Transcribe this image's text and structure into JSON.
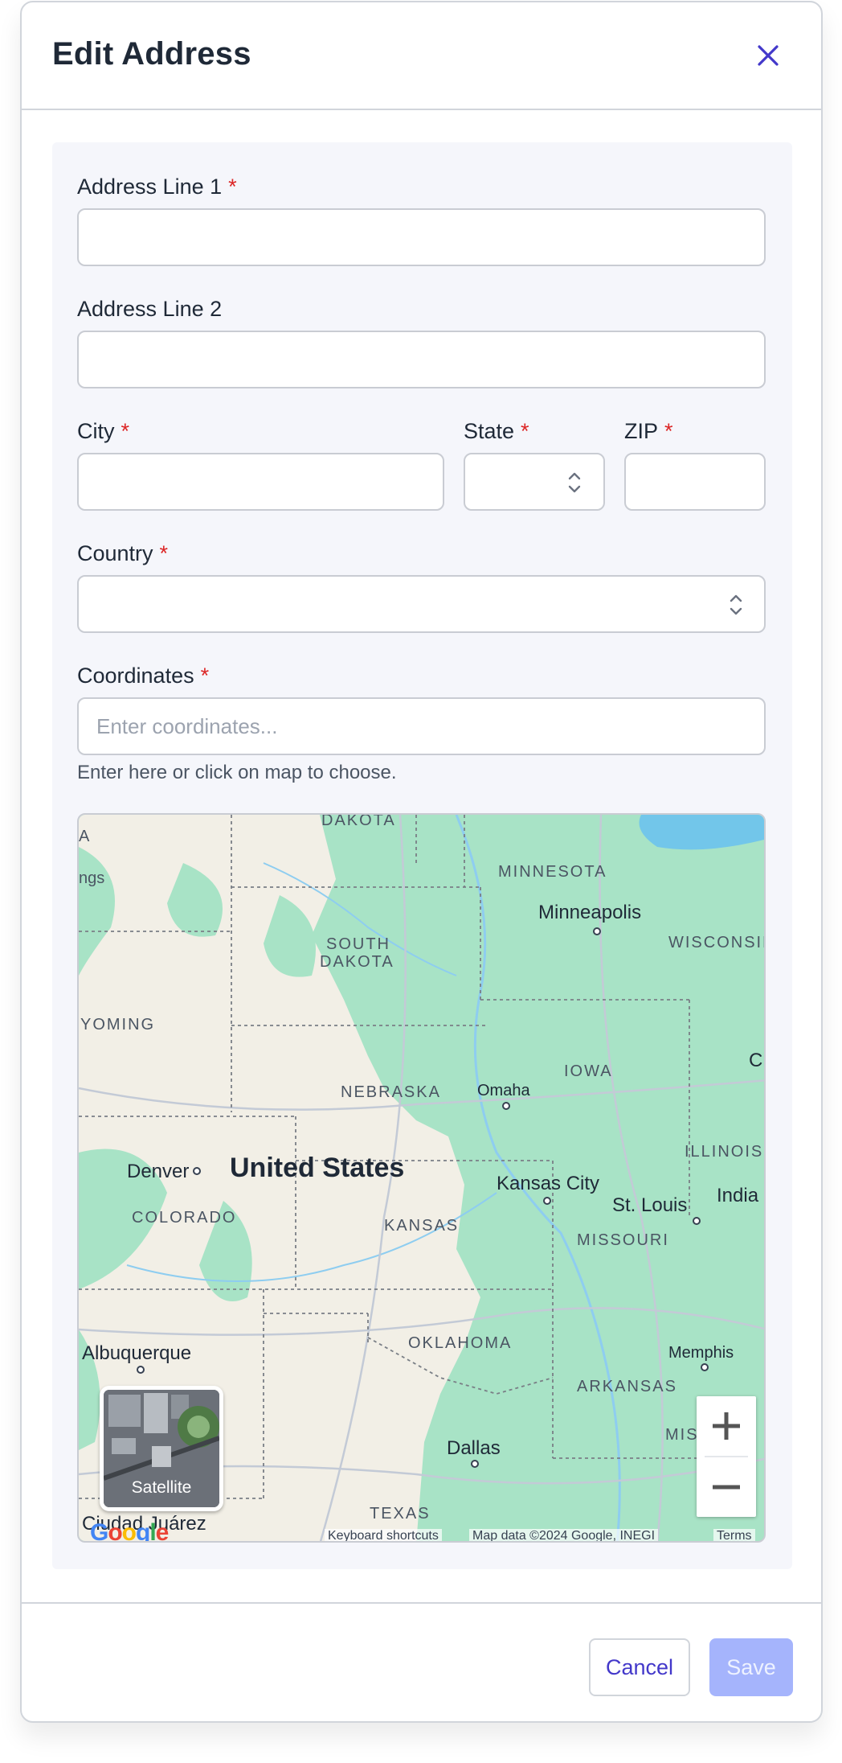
{
  "dialog": {
    "title": "Edit Address",
    "close_icon": "close-icon"
  },
  "form": {
    "address_line1": {
      "label": "Address Line 1",
      "required": "*",
      "value": ""
    },
    "address_line2": {
      "label": "Address Line 2",
      "value": ""
    },
    "city": {
      "label": "City",
      "required": "*",
      "value": ""
    },
    "state": {
      "label": "State",
      "required": "*",
      "value": ""
    },
    "zip": {
      "label": "ZIP",
      "required": "*",
      "value": ""
    },
    "country": {
      "label": "Country",
      "required": "*",
      "value": ""
    },
    "coordinates": {
      "label": "Coordinates",
      "required": "*",
      "placeholder": "Enter coordinates...",
      "value": "",
      "hint": "Enter here or click on map to choose."
    }
  },
  "map": {
    "country_label": "United States",
    "state_labels": [
      "DAKOTA",
      "MINNESOTA",
      "SOUTH",
      "DAKOTA",
      "WISCONSIN",
      "YOMING",
      "IOWA",
      "NEBRASKA",
      "ILLINOIS",
      "COLORADO",
      "KANSAS",
      "MISSOURI",
      "OKLAHOMA",
      "ARKANSAS",
      "TEXAS",
      "MIS",
      "A",
      "ngs",
      "Ci",
      "India"
    ],
    "cities": [
      "Minneapolis",
      "Omaha",
      "Denver",
      "Kansas City",
      "St. Louis",
      "Albuquerque",
      "Memphis",
      "Dallas",
      "Ciudad Juárez"
    ],
    "satellite_label": "Satellite",
    "zoom_in": "+",
    "zoom_out": "−",
    "google_letters": [
      "G",
      "o",
      "o",
      "g",
      "l",
      "e"
    ],
    "attribution": [
      "Keyboard shortcuts",
      "Map data ©2024 Google, INEGI",
      "Terms"
    ],
    "colors": {
      "land": "#f2efe6",
      "vegetation": "#a8e3c6",
      "water": "#72c6ea",
      "border": "#7a7f86"
    }
  },
  "footer": {
    "cancel_label": "Cancel",
    "save_label": "Save"
  },
  "colors": {
    "accent": "#4338ca",
    "required": "#dc2626",
    "save_disabled": "#a5b4fc"
  }
}
